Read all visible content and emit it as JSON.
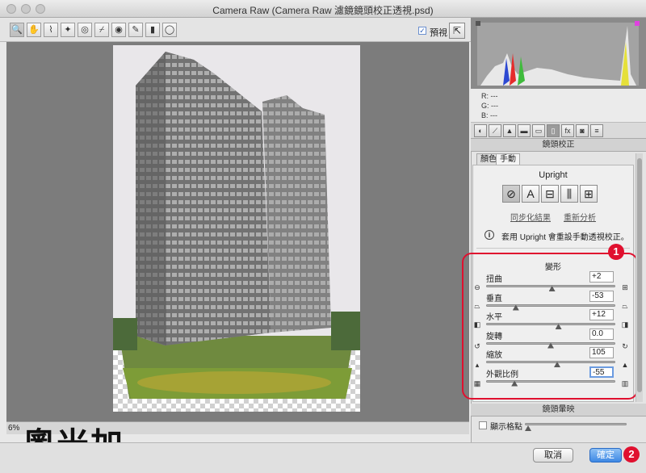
{
  "window": {
    "title": "Camera Raw (Camera Raw 濾鏡鏡頭校正透視.psd)"
  },
  "toolbar": {
    "tools": [
      {
        "name": "zoom-tool-icon",
        "glyph": "🔍"
      },
      {
        "name": "hand-tool-icon",
        "glyph": "✋"
      },
      {
        "name": "white-balance-tool-icon",
        "glyph": "⌇"
      },
      {
        "name": "color-sampler-tool-icon",
        "glyph": "✦"
      },
      {
        "name": "targeted-adjustment-tool-icon",
        "glyph": "◎"
      },
      {
        "name": "straighten-tool-icon",
        "glyph": "⌿"
      },
      {
        "name": "red-eye-tool-icon",
        "glyph": "◉"
      },
      {
        "name": "adjustment-brush-icon",
        "glyph": "✎"
      },
      {
        "name": "graduated-filter-icon",
        "glyph": "▮"
      },
      {
        "name": "radial-filter-icon",
        "glyph": "◯"
      }
    ],
    "preview_label": "預視",
    "preview_checked": "✓"
  },
  "histogram": {
    "r": "R:",
    "g": "G:",
    "b": "B:",
    "dashes": "---"
  },
  "panel": {
    "section_title": "鏡頭校正",
    "subtabs": [
      "顏色",
      "手動"
    ],
    "upright": {
      "title": "Upright",
      "buttons": [
        {
          "name": "upright-off-icon",
          "glyph": "⊘"
        },
        {
          "name": "upright-auto-icon",
          "glyph": "A"
        },
        {
          "name": "upright-level-icon",
          "glyph": "⊟"
        },
        {
          "name": "upright-vertical-icon",
          "glyph": "⫼"
        },
        {
          "name": "upright-full-icon",
          "glyph": "⊞"
        }
      ],
      "sync_link": "同步化結果",
      "reanalyze_link": "重新分析",
      "info": "套用 Upright 會重設手動透視校正。"
    },
    "transform": {
      "title": "變形",
      "sliders": [
        {
          "label": "扭曲",
          "value": "+2",
          "fraction": 0.51
        },
        {
          "label": "垂直",
          "value": "-53",
          "fraction": 0.23
        },
        {
          "label": "水平",
          "value": "+12",
          "fraction": 0.56
        },
        {
          "label": "旋轉",
          "value": "0.0",
          "fraction": 0.5
        },
        {
          "label": "縮放",
          "value": "105",
          "fraction": 0.55
        },
        {
          "label": "外觀比例",
          "value": "-55",
          "fraction": 0.22
        }
      ]
    },
    "vignetting_title": "鏡頭暈映",
    "grid_label": "顯示格點"
  },
  "footer": {
    "zoom": "6%",
    "logo": "奧米加",
    "cancel": "取消",
    "ok": "確定",
    "badge1": "1",
    "badge2": "2"
  },
  "colors": {
    "accent": "#3e88e4",
    "annotation": "#e0102f"
  }
}
